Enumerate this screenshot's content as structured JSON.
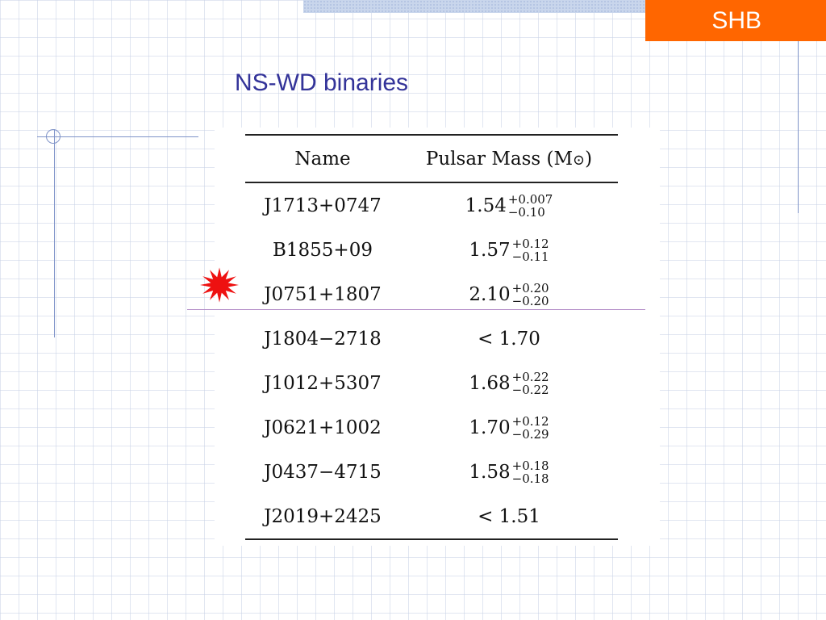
{
  "header": {
    "badge": "SHB",
    "title": "NS-WD binaries"
  },
  "table": {
    "headers": {
      "name": "Name",
      "mass": "Pulsar Mass (M",
      "mass_close": ")",
      "sun_symbol": "⊙"
    },
    "rows": [
      {
        "name": "J1713+0747",
        "value": "1.54",
        "plus": "+0.007",
        "minus": "−0.10"
      },
      {
        "name": "B1855+09",
        "value": "1.57",
        "plus": "+0.12",
        "minus": "−0.11"
      },
      {
        "name": "J0751+1807",
        "value": "2.10",
        "plus": "+0.20",
        "minus": "−0.20"
      },
      {
        "name": "J1804−2718",
        "value": "< 1.70",
        "plus": "",
        "minus": ""
      },
      {
        "name": "J1012+5307",
        "value": "1.68",
        "plus": "+0.22",
        "minus": "−0.22"
      },
      {
        "name": "J0621+1002",
        "value": "1.70",
        "plus": "+0.12",
        "minus": "−0.29"
      },
      {
        "name": "J0437−4715",
        "value": "1.58",
        "plus": "+0.18",
        "minus": "−0.18"
      },
      {
        "name": "J2019+2425",
        "value": "< 1.51",
        "plus": "",
        "minus": ""
      }
    ]
  },
  "colors": {
    "badge_bg": "#ff6600",
    "title": "#333399",
    "star": "#ee1111"
  },
  "icons": {
    "highlight": "red-star-burst-icon"
  }
}
